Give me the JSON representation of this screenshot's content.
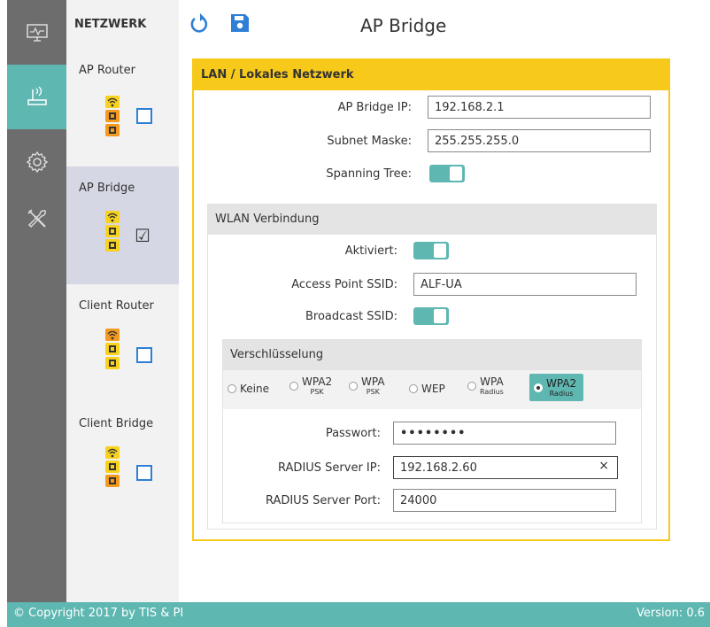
{
  "sidebar": {
    "items": [
      {
        "icon": "monitor-icon",
        "active": false
      },
      {
        "icon": "router-icon",
        "active": true
      },
      {
        "icon": "gear-icon",
        "active": false
      },
      {
        "icon": "tools-icon",
        "active": false
      }
    ]
  },
  "network": {
    "header": "NETZWERK",
    "items": [
      {
        "label": "AP Router",
        "selected": false
      },
      {
        "label": "AP Bridge",
        "selected": true
      },
      {
        "label": "Client Router",
        "selected": false
      },
      {
        "label": "Client Bridge",
        "selected": false
      }
    ]
  },
  "topbar": {
    "title": "AP Bridge",
    "undo_icon": "undo-icon",
    "save_icon": "save-icon"
  },
  "lan": {
    "header": "LAN / Lokales Netzwerk",
    "ip_label": "AP Bridge IP:",
    "ip_value": "192.168.2.1",
    "mask_label": "Subnet Maske:",
    "mask_value": "255.255.255.0",
    "stp_label": "Spanning Tree:",
    "stp_on": true
  },
  "wlan": {
    "header": "WLAN Verbindung",
    "enabled_label": "Aktiviert:",
    "enabled_on": true,
    "ssid_label": "Access Point SSID:",
    "ssid_value": "ALF-UA",
    "broadcast_label": "Broadcast SSID:",
    "broadcast_on": true
  },
  "encryption": {
    "header": "Verschlüsselung",
    "options": [
      {
        "main": "Keine",
        "sub": ""
      },
      {
        "main": "WPA2",
        "sub": "PSK"
      },
      {
        "main": "WPA",
        "sub": "PSK"
      },
      {
        "main": "WEP",
        "sub": ""
      },
      {
        "main": "WPA",
        "sub": "Radius"
      },
      {
        "main": "WPA2",
        "sub": "Radius"
      }
    ],
    "selected": "WPA2 Radius",
    "password_label": "Passwort:",
    "password_value": "••••••••",
    "radius_ip_label": "RADIUS Server IP:",
    "radius_ip_value": "192.168.2.60",
    "radius_clear": "×",
    "radius_port_label": "RADIUS Server Port:",
    "radius_port_value": "24000"
  },
  "footer": {
    "copyright": "© Copyright 2017 by TIS & PI",
    "version": "Version: 0.6"
  },
  "colors": {
    "accent_teal": "#5fb7b1",
    "yellow": "#f7c91b",
    "sidebar_gray": "#6d6d6d",
    "icon_blue": "#2f7fd6"
  }
}
